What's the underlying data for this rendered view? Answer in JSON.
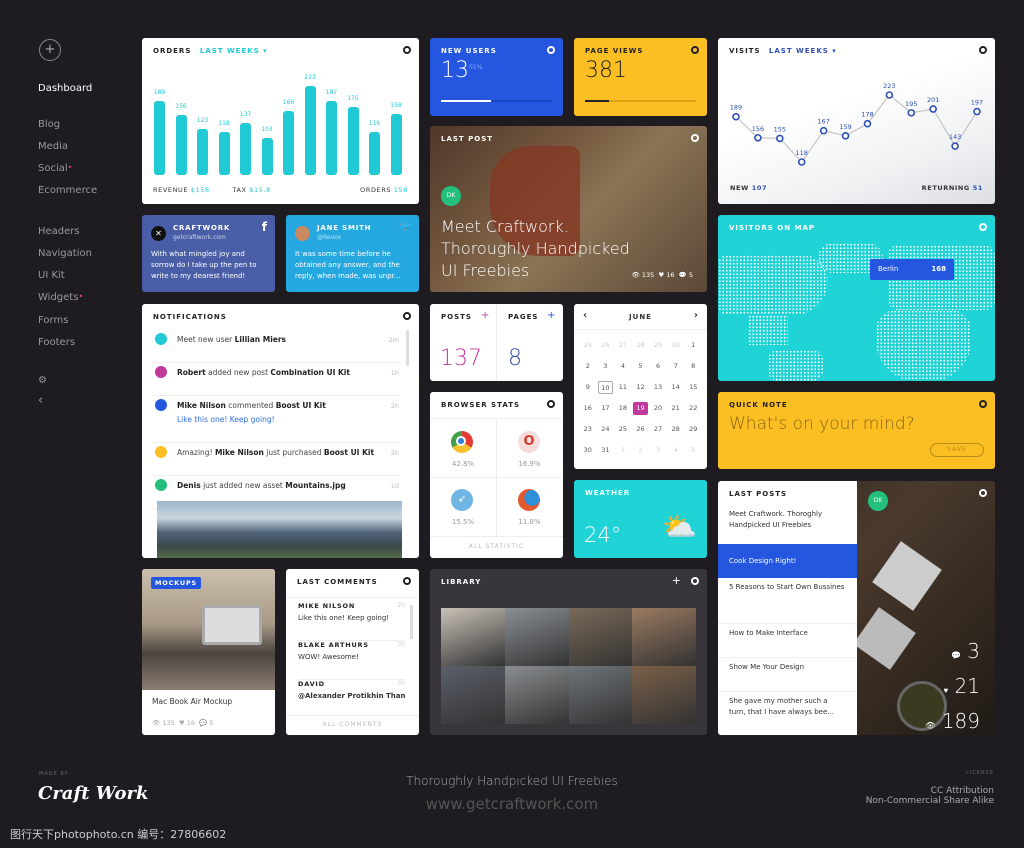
{
  "sidebar": {
    "items": [
      {
        "label": "Dashboard"
      },
      {
        "label": "Blog"
      },
      {
        "label": "Media"
      },
      {
        "label": "Social",
        "badge": true
      },
      {
        "label": "Ecommerce"
      },
      {
        "label": "Headers"
      },
      {
        "label": "Navigation"
      },
      {
        "label": "UI Kit"
      },
      {
        "label": "Widgets",
        "badge": true
      },
      {
        "label": "Forms"
      },
      {
        "label": "Footers"
      }
    ],
    "add_icon": "+",
    "settings_icon": "⚙",
    "collapse_icon": "‹"
  },
  "orders": {
    "title": "ORDERS",
    "filter": "LAST WEEKS ▾",
    "revenue_label": "REVENUE",
    "revenue": "$158",
    "tax_label": "TAX",
    "tax": "$15.8",
    "orders_label": "ORDERS",
    "orders": "158"
  },
  "chart_data": [
    {
      "type": "bar",
      "values": [
        189,
        156,
        123,
        118,
        137,
        103,
        166,
        223,
        187,
        175,
        116,
        158
      ],
      "color": "#20c9d4"
    },
    {
      "type": "line",
      "values": [
        189,
        156,
        155,
        118,
        167,
        159,
        178,
        223,
        195,
        201,
        143,
        197
      ],
      "color": "#2f4fb3"
    }
  ],
  "new_users": {
    "title": "NEW USERS",
    "value": "13",
    "pct": "65%",
    "progress": 0.45,
    "color": "#2456e0"
  },
  "page_views": {
    "title": "PAGE VIEWS",
    "value": "381",
    "progress": 0.22,
    "color": "#fbbf24"
  },
  "visits": {
    "title": "VISITS",
    "filter": "LAST WEEKS ▾",
    "new_label": "NEW",
    "new": "107",
    "returning_label": "RETURNING",
    "returning": "51"
  },
  "social": {
    "fb": {
      "name": "CRAFTWORK",
      "handle": "getcraftwork.com",
      "text": "With what mingled joy and sorrow do I take up the pen to write to my dearest friend!",
      "icon": "f"
    },
    "tw": {
      "name": "JANE SMITH",
      "handle": "@Revox",
      "text": "It was some time before he obtained any answer, and the reply, when made, was unpr...",
      "icon": "twitter"
    }
  },
  "last_post": {
    "title": "LAST POST",
    "avatar": "DK",
    "headline": "Meet Craftwork. Thoroughly Handpicked UI Freebies",
    "views": "135",
    "likes": "16",
    "comments": "5"
  },
  "map": {
    "title": "VISITORS ON MAP",
    "city": "Berlin",
    "count": "168"
  },
  "notifications": {
    "title": "NOTIFICATIONS",
    "items": [
      {
        "pre": "Meet new user ",
        "b1": "Lillian Miers",
        "mid": "",
        "b2": "",
        "time": "2m",
        "color": "#20c9d4",
        "sub": ""
      },
      {
        "pre": "",
        "b1": "Robert",
        "mid": " added new post ",
        "b2": "Combination UI Kit",
        "time": "1h",
        "color": "#c0399b",
        "sub": ""
      },
      {
        "pre": "",
        "b1": "Mike Nilson",
        "mid": " commented ",
        "b2": "Boost UI Kit",
        "time": "2h",
        "color": "#2456e0",
        "sub": "Like this one! Keep going!"
      },
      {
        "pre": "Amazing! ",
        "b1": "Mike Nilson",
        "mid": " just purchased ",
        "b2": "Boost UI Kit",
        "time": "2h",
        "color": "#fbbf24",
        "sub": ""
      },
      {
        "pre": "",
        "b1": "Denis",
        "mid": " just added new asset ",
        "b2": "Mountains.jpg",
        "time": "1d",
        "color": "#22c07a",
        "sub": ""
      }
    ]
  },
  "posts": {
    "label": "POSTS",
    "value": "137"
  },
  "pages": {
    "label": "PAGES",
    "value": "8"
  },
  "calendar": {
    "month": "JUNE",
    "days": [
      "25",
      "26",
      "27",
      "28",
      "29",
      "30",
      "1",
      "2",
      "3",
      "4",
      "5",
      "6",
      "7",
      "8",
      "9",
      "10",
      "11",
      "12",
      "13",
      "14",
      "15",
      "16",
      "17",
      "18",
      "19",
      "20",
      "21",
      "22",
      "23",
      "24",
      "25",
      "26",
      "27",
      "28",
      "29",
      "30",
      "31",
      "1",
      "2",
      "3",
      "4",
      "5"
    ],
    "today": "10",
    "selected": "19"
  },
  "quick_note": {
    "title": "QUICK NOTE",
    "placeholder": "What's on your mind?",
    "save": "SAVE"
  },
  "browser": {
    "title": "BROWSER STATS",
    "items": [
      {
        "name": "chrome",
        "value": "42.8%"
      },
      {
        "name": "opera",
        "value": "16.9%"
      },
      {
        "name": "safari",
        "value": "15.5%"
      },
      {
        "name": "firefox",
        "value": "11.8%"
      }
    ],
    "footer": "ALL STATISTIC"
  },
  "weather": {
    "title": "WEATHER",
    "temp": "24°"
  },
  "last_posts": {
    "title": "LAST POSTS",
    "items": [
      "Meet Craftwork. Thoroghly Handpicked UI Freebies",
      "Cook Design Right!",
      "5 Reasons to Start Own Bussines",
      "How to Make Interface",
      "Show Me Your Design",
      "She gave my mother such a turn, that I have always bee..."
    ],
    "avatar": "DK",
    "comments": "3",
    "likes": "21",
    "views": "189"
  },
  "mockups": {
    "badge": "MOCKUPS",
    "title": "Mac Book Air Mockup",
    "views": "135",
    "likes": "16",
    "comments": "5"
  },
  "comments": {
    "title": "LAST COMMENTS",
    "items": [
      {
        "name": "MIKE NILSON",
        "text": "Like this one! Keep going!",
        "time": "2h"
      },
      {
        "name": "BLAKE ARTHURS",
        "text": "WOW! Awesome!",
        "time": "3h"
      },
      {
        "name": "DAVID",
        "text": "@Alexander Protikhin Than-",
        "time": "3h"
      }
    ],
    "footer": "ALL COMMENTS"
  },
  "library": {
    "title": "LIBRARY"
  },
  "footer": {
    "made_by": "MADE BY",
    "logo": "Craft Work",
    "tagline": "Thoroughly Handpicked UI Freebies",
    "url": "www.getcraftwork.com",
    "license_label": "LICENSE",
    "license1": "CC Attribution",
    "license2": "Non-Commercial Share Alike",
    "watermark": "图行天下photophoto.cn  编号：27806602"
  }
}
